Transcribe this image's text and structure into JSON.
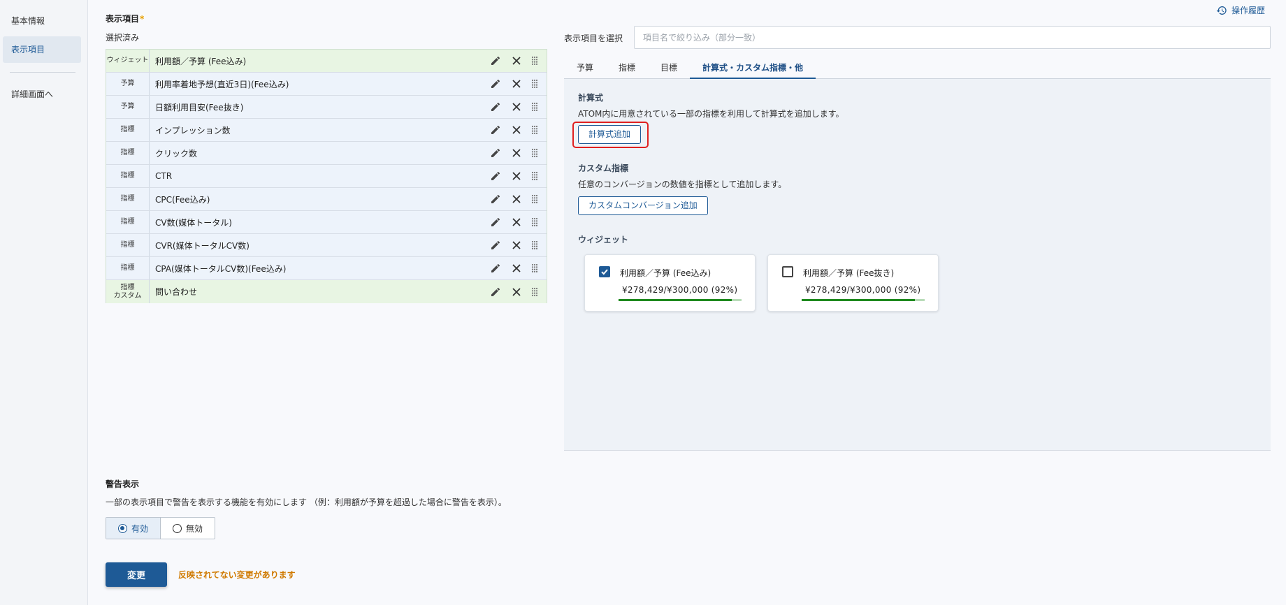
{
  "sidebar": {
    "items": [
      {
        "label": "基本情報"
      },
      {
        "label": "表示項目"
      },
      {
        "label": "詳細画面へ"
      }
    ]
  },
  "history": {
    "label": "操作履歴",
    "icon": "history-icon"
  },
  "display_items": {
    "title": "表示項目",
    "required_mark": "*",
    "selected_label": "選択済み",
    "rows": [
      {
        "type": "ウィジェット",
        "type2": "",
        "label": "利用額／予算 (Fee込み)",
        "tone": "green"
      },
      {
        "type": "予算",
        "type2": "",
        "label": "利用率着地予想(直近3日)(Fee込み)",
        "tone": "blue"
      },
      {
        "type": "予算",
        "type2": "",
        "label": "日額利用目安(Fee抜き)",
        "tone": "blue"
      },
      {
        "type": "指標",
        "type2": "",
        "label": "インプレッション数",
        "tone": "blue"
      },
      {
        "type": "指標",
        "type2": "",
        "label": "クリック数",
        "tone": "blue"
      },
      {
        "type": "指標",
        "type2": "",
        "label": "CTR",
        "tone": "blue"
      },
      {
        "type": "指標",
        "type2": "",
        "label": "CPC(Fee込み)",
        "tone": "blue"
      },
      {
        "type": "指標",
        "type2": "",
        "label": "CV数(媒体トータル)",
        "tone": "blue"
      },
      {
        "type": "指標",
        "type2": "",
        "label": "CVR(媒体トータルCV数)",
        "tone": "blue"
      },
      {
        "type": "指標",
        "type2": "",
        "label": "CPA(媒体トータルCV数)(Fee込み)",
        "tone": "blue"
      },
      {
        "type": "指標",
        "type2": "カスタム",
        "label": "問い合わせ",
        "tone": "green"
      }
    ]
  },
  "selector": {
    "label": "表示項目を選択",
    "search_placeholder": "項目名で絞り込み（部分一致）",
    "tabs": [
      {
        "label": "予算"
      },
      {
        "label": "指標"
      },
      {
        "label": "目標"
      },
      {
        "label": "計算式・カスタム指標・他",
        "active": true
      }
    ],
    "formula": {
      "title": "計算式",
      "description": "ATOM内に用意されている一部の指標を利用して計算式を追加します。",
      "button": "計算式追加"
    },
    "custom": {
      "title": "カスタム指標",
      "description": "任意のコンバージョンの数値を指標として追加します。",
      "button": "カスタムコンバージョン追加"
    },
    "widgets": {
      "title": "ウィジェット",
      "cards": [
        {
          "title": "利用額／予算 (Fee込み)",
          "value": "¥278,429/¥300,000 (92%)",
          "progress": 0.92,
          "checked": true
        },
        {
          "title": "利用額／予算 (Fee抜き)",
          "value": "¥278,429/¥300,000 (92%)",
          "progress": 0.92,
          "checked": false
        }
      ]
    }
  },
  "warning": {
    "title": "警告表示",
    "description": "一部の表示項目で警告を表示する機能を有効にします （例：利用額が予算を超過した場合に警告を表示）。",
    "options": [
      {
        "label": "有効",
        "selected": true
      },
      {
        "label": "無効",
        "selected": false
      }
    ]
  },
  "footer": {
    "save_label": "変更",
    "unsaved_message": "反映されてない変更があります"
  },
  "colors": {
    "accent": "#1e5a96",
    "warning_text": "#d07a00",
    "highlight": "#e02020",
    "progress": "#1f8a1f"
  }
}
